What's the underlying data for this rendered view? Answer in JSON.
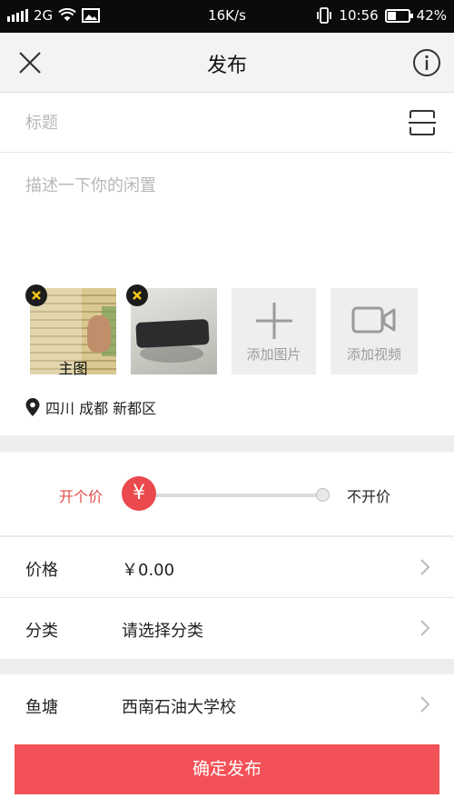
{
  "status_bar": {
    "network": "2G",
    "speed": "16K/s",
    "time": "10:56",
    "battery_percent": 42,
    "battery_label": "42%"
  },
  "nav": {
    "title": "发布",
    "close_icon": "close-icon",
    "info_icon": "info-icon"
  },
  "form": {
    "title_placeholder": "标题",
    "description_placeholder": "描述一下你的闲置",
    "scan_icon": "scan-icon"
  },
  "photos": {
    "main_label": "主图",
    "add_photo_label": "添加图片",
    "add_video_label": "添加视频"
  },
  "location": {
    "icon": "location-pin-icon",
    "text": "四川 成都 新都区"
  },
  "price_mode": {
    "on_label": "开个价",
    "off_label": "不开价",
    "knob_symbol": "¥",
    "accent_color": "#ea4a4d"
  },
  "details": {
    "price_label": "价格",
    "price_value": "￥0.00",
    "category_label": "分类",
    "category_value": "请选择分类",
    "pond_label": "鱼塘",
    "pond_value": "西南石油大学校"
  },
  "submit": {
    "label": "确定发布",
    "color": "#f25257"
  }
}
